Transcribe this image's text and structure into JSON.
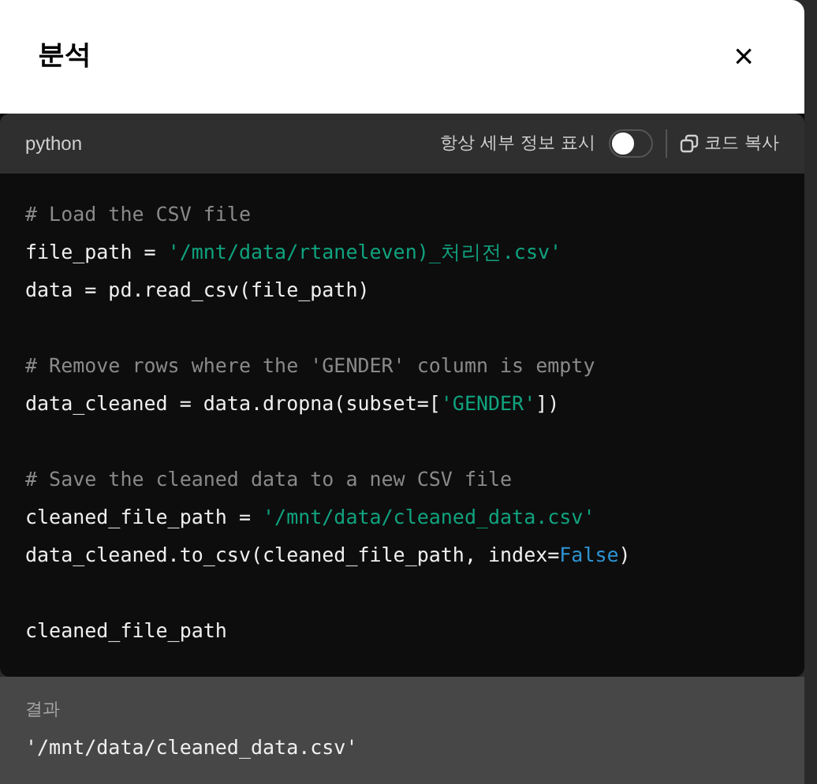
{
  "dialog": {
    "title": "분석",
    "close_label": "×"
  },
  "code": {
    "language": "python",
    "always_show_details": {
      "label": "항상 세부 정보 표시",
      "on": false
    },
    "copy_label": "코드 복사",
    "blocks": [
      [
        [
          {
            "kind": "comment",
            "text": "# Load the CSV file"
          }
        ],
        [
          {
            "kind": "plain",
            "text": "file_path = "
          },
          {
            "kind": "string",
            "text": "'/mnt/data/rtaneleven)_처리전.csv'"
          }
        ],
        [
          {
            "kind": "plain",
            "text": "data = pd.read_csv(file_path)"
          }
        ]
      ],
      [
        [
          {
            "kind": "comment",
            "text": "# Remove rows where the 'GENDER' column is empty"
          }
        ],
        [
          {
            "kind": "plain",
            "text": "data_cleaned = data.dropna(subset=["
          },
          {
            "kind": "string",
            "text": "'GENDER'"
          },
          {
            "kind": "plain",
            "text": "])"
          }
        ]
      ],
      [
        [
          {
            "kind": "comment",
            "text": "# Save the cleaned data to a new CSV file"
          }
        ],
        [
          {
            "kind": "plain",
            "text": "cleaned_file_path = "
          },
          {
            "kind": "string",
            "text": "'/mnt/data/cleaned_data.csv'"
          }
        ],
        [
          {
            "kind": "plain",
            "text": "data_cleaned.to_csv(cleaned_file_path, index="
          },
          {
            "kind": "keyword",
            "text": "False"
          },
          {
            "kind": "plain",
            "text": ")"
          }
        ]
      ],
      [
        [
          {
            "kind": "plain",
            "text": "cleaned_file_path"
          }
        ]
      ]
    ]
  },
  "result": {
    "label": "결과",
    "value": "'/mnt/data/cleaned_data.csv'"
  }
}
